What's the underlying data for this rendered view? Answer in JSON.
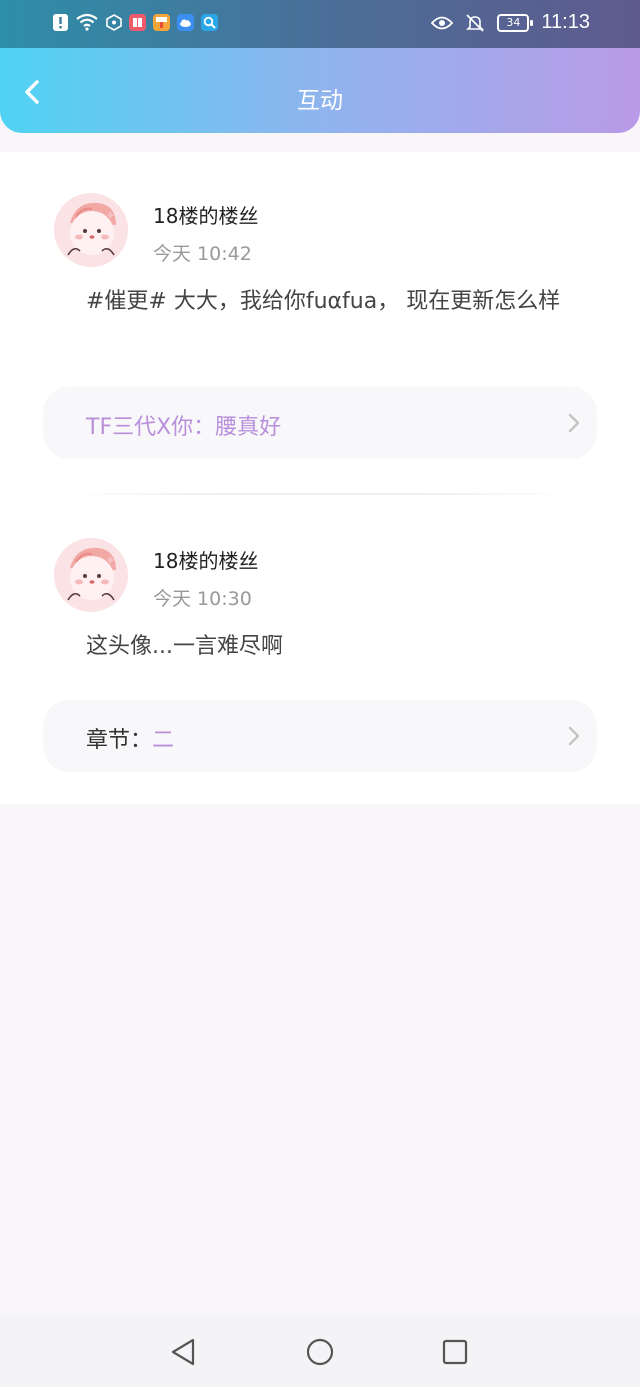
{
  "status_bar": {
    "time": "11:13",
    "battery": "34",
    "left_icons": [
      "alert-icon",
      "wifi-icon",
      "hexagon-icon",
      "book-app-icon",
      "paint-app-icon",
      "cloud-app-icon",
      "search-app-icon"
    ],
    "right_icons": [
      "eye-icon",
      "bell-off-icon",
      "battery-icon"
    ]
  },
  "header": {
    "title": "互动",
    "back_icon": "chevron-left-icon",
    "gradient_start": "#4fd3f2",
    "gradient_end": "#b99ae8"
  },
  "interactions": [
    {
      "user_name": "18楼的楼丝",
      "time": "今天 10:42",
      "content": "#催更# 大大，我给你fuαfua， 现在更新怎么样",
      "ref_label": "",
      "ref_value": "TF三代X你：腰真好"
    },
    {
      "user_name": "18楼的楼丝",
      "time": "今天 10:30",
      "content": "这头像...一言难尽啊",
      "ref_label": "章节：",
      "ref_value": "二"
    }
  ],
  "colors": {
    "accent_purple": "#b98fdc",
    "text_gray": "#999999"
  },
  "nav_bar": {
    "icons": [
      "back-triangle-icon",
      "home-circle-icon",
      "recent-square-icon"
    ]
  }
}
